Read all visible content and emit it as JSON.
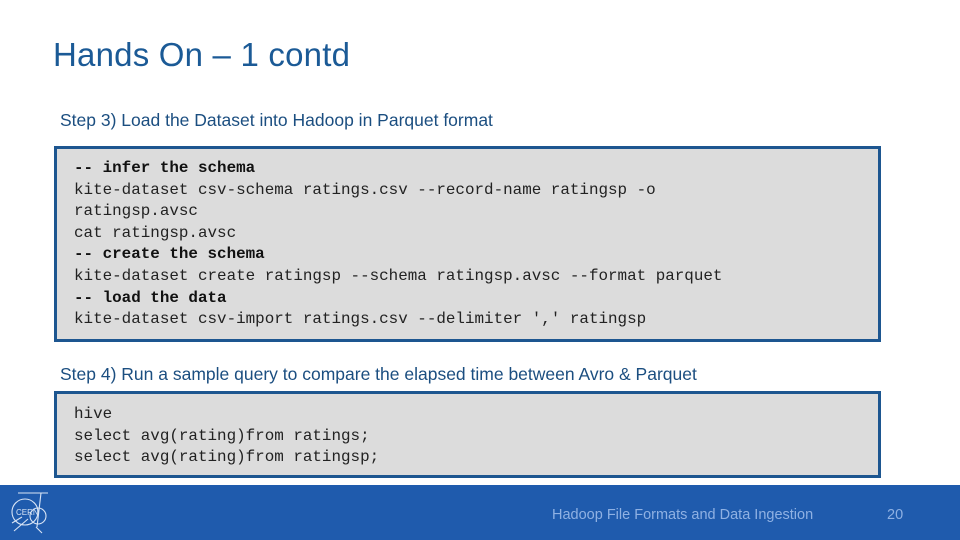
{
  "slide": {
    "title": "Hands On – 1 contd",
    "step3": {
      "heading": "Step 3) Load the Dataset into Hadoop in Parquet format",
      "code_lines": [
        {
          "text": "-- infer the schema",
          "comment": true
        },
        {
          "text": "kite-dataset csv-schema ratings.csv --record-name ratingsp -o",
          "comment": false
        },
        {
          "text": "ratingsp.avsc",
          "comment": false
        },
        {
          "text": "cat ratingsp.avsc",
          "comment": false
        },
        {
          "text": "-- create the schema",
          "comment": true
        },
        {
          "text": "kite-dataset create ratingsp --schema ratingsp.avsc --format parquet",
          "comment": false
        },
        {
          "text": "-- load the data",
          "comment": true
        },
        {
          "text": "kite-dataset csv-import ratings.csv --delimiter ',' ratingsp",
          "comment": false
        }
      ]
    },
    "step4": {
      "heading": "Step 4) Run a sample query to compare the elapsed time between Avro & Parquet",
      "code_lines": [
        {
          "text": "hive",
          "comment": false
        },
        {
          "text": "select avg(rating)from ratings;",
          "comment": false
        },
        {
          "text": "select avg(rating)from ratingsp;",
          "comment": false
        }
      ]
    }
  },
  "footer": {
    "logo": "cern-logo-icon",
    "text": "Hadoop File Formats and Data Ingestion",
    "page_number": "20"
  },
  "colors": {
    "title": "#1b5a96",
    "heading": "#1b4e80",
    "code_border": "#1d5690",
    "code_background": "#dcdcdc",
    "footer_background": "#1f5bad",
    "footer_text": "#8fb1e3"
  }
}
